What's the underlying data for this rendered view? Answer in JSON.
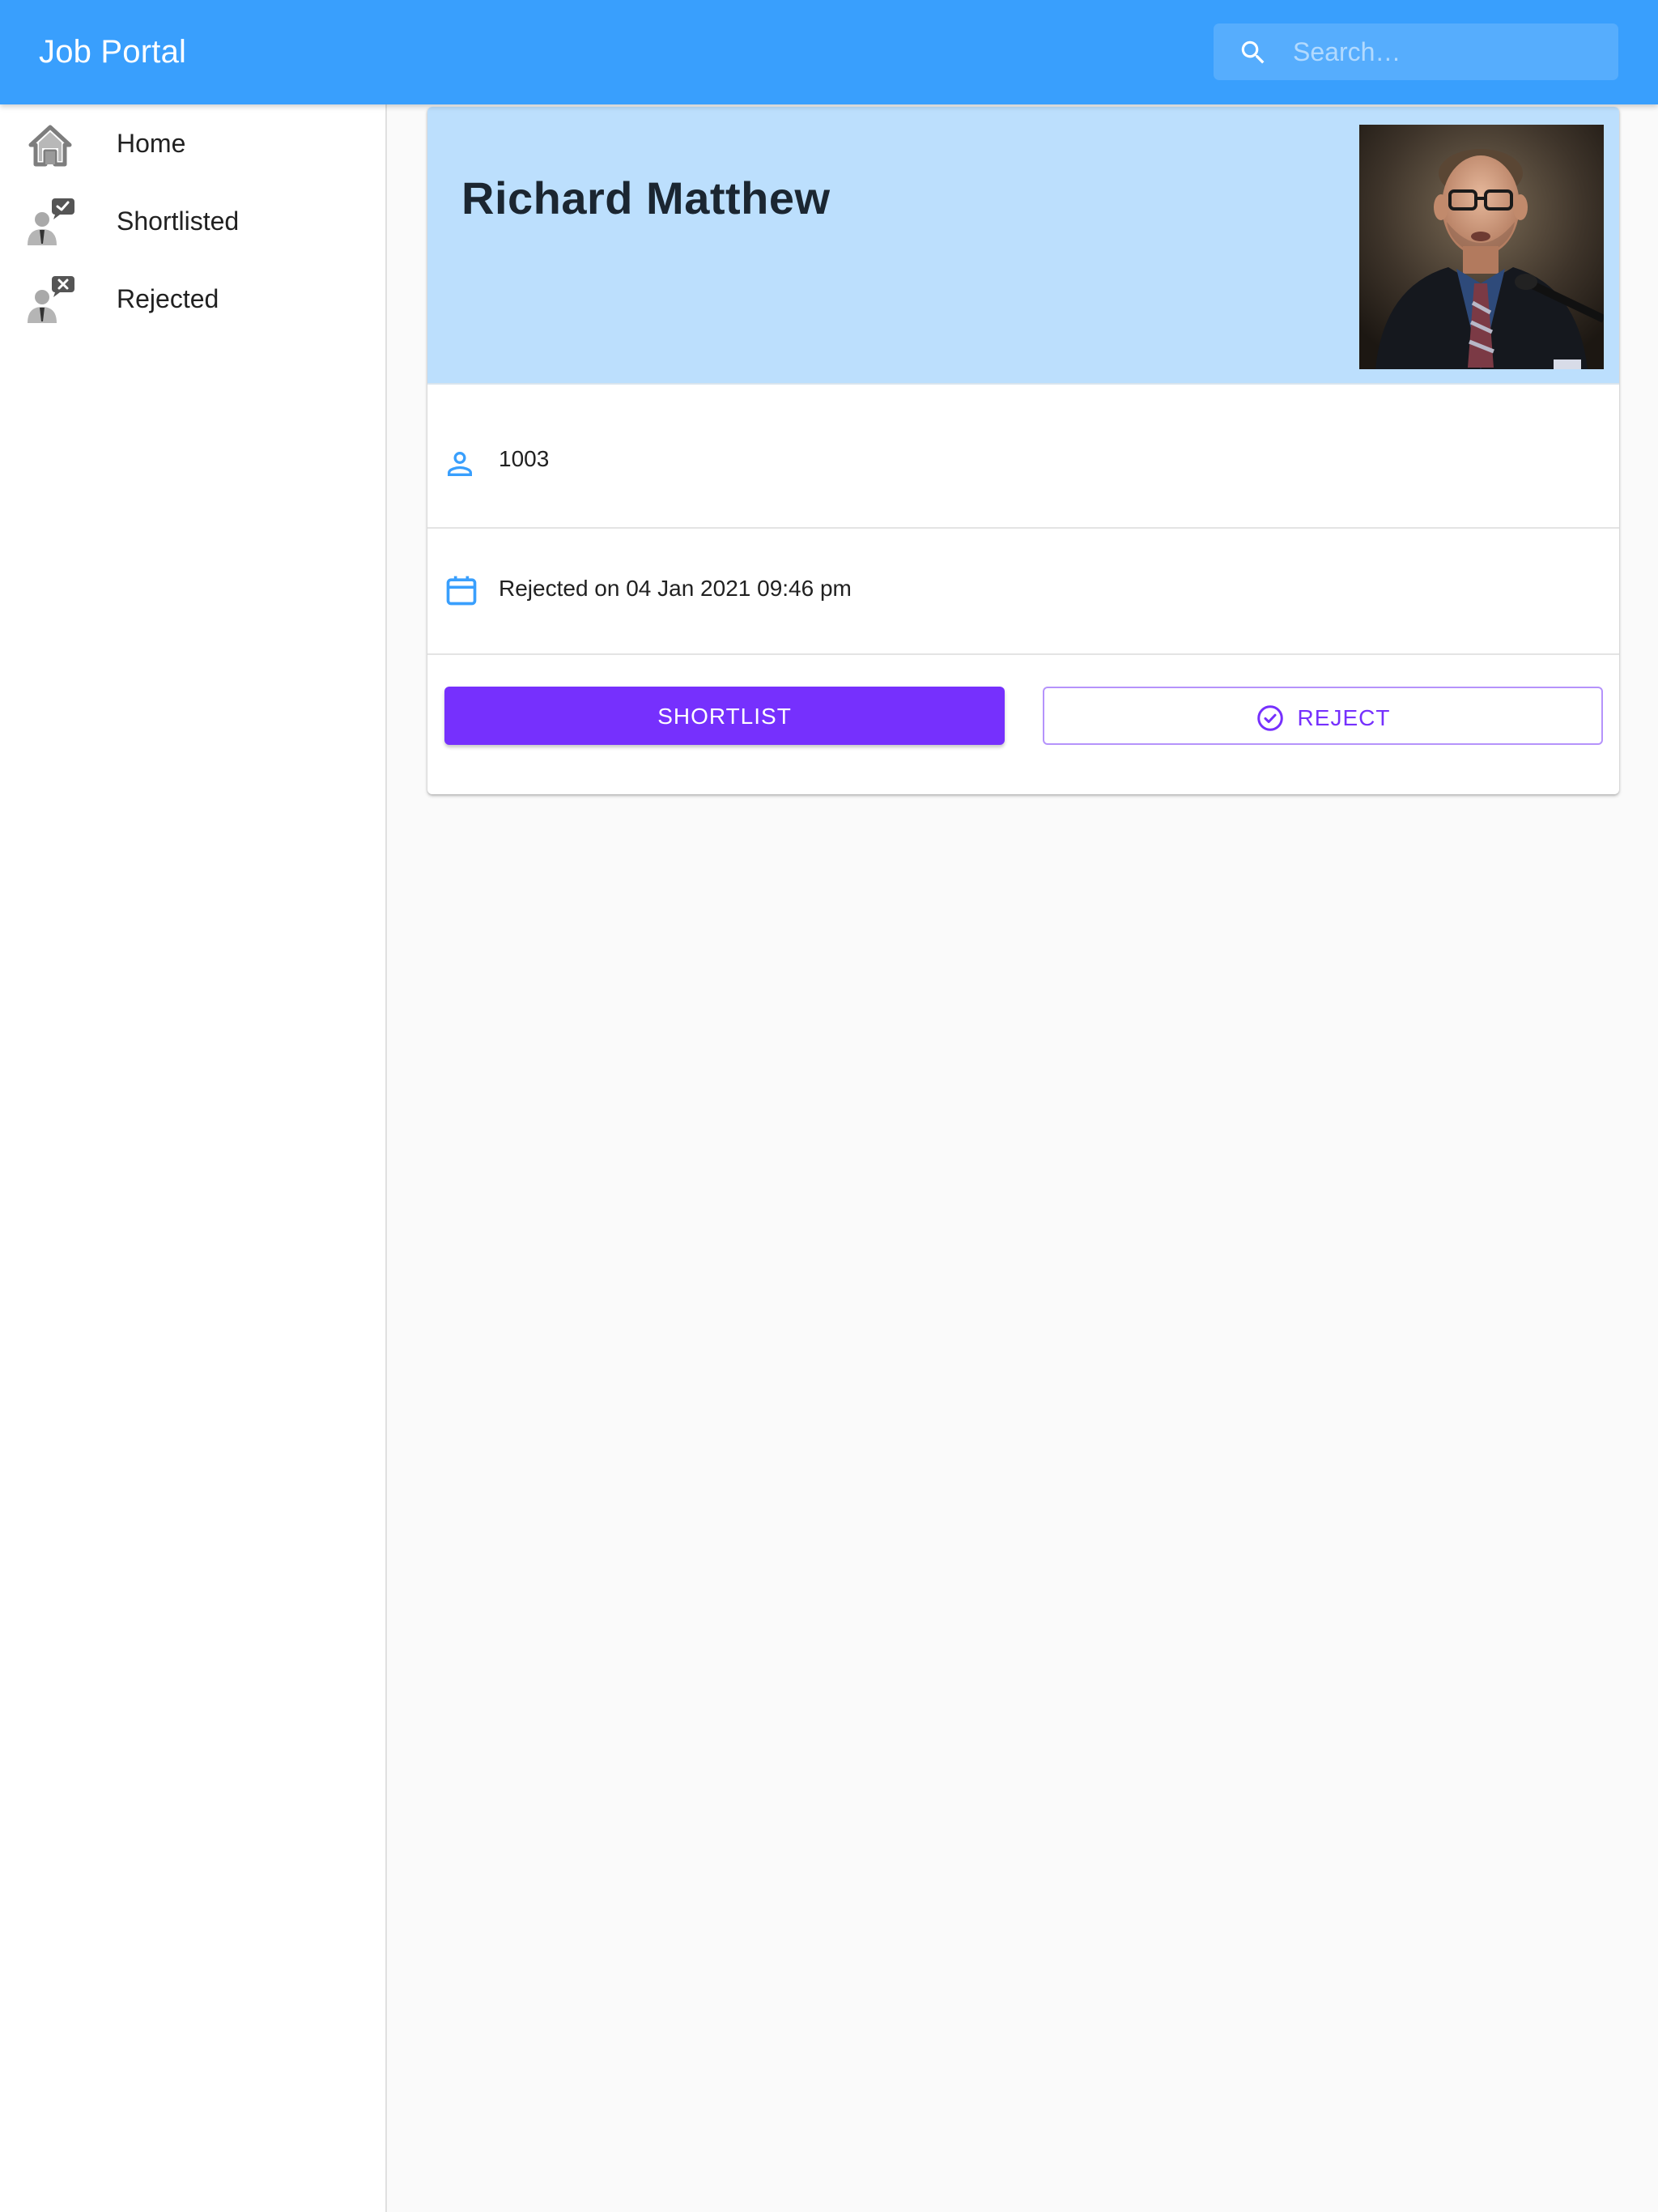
{
  "appbar": {
    "title": "Job Portal",
    "search_placeholder": "Search…",
    "search_icon": "search-icon",
    "color": "#399ffd"
  },
  "sidebar": {
    "items": [
      {
        "label": "Home",
        "icon": "home-icon"
      },
      {
        "label": "Shortlisted",
        "icon": "user-check-icon"
      },
      {
        "label": "Rejected",
        "icon": "user-cross-icon"
      }
    ]
  },
  "candidate": {
    "name": "Richard Matthew",
    "id": "1003",
    "id_icon": "person-icon",
    "status_text": "Rejected on 04 Jan 2021 09:46 pm",
    "status_icon": "calendar-icon",
    "photo": "candidate-photo",
    "header_color": "#bcdffd"
  },
  "actions": {
    "shortlist_label": "SHORTLIST",
    "reject_label": "REJECT",
    "reject_icon": "check-circle-icon",
    "accent": "#7630fd"
  }
}
